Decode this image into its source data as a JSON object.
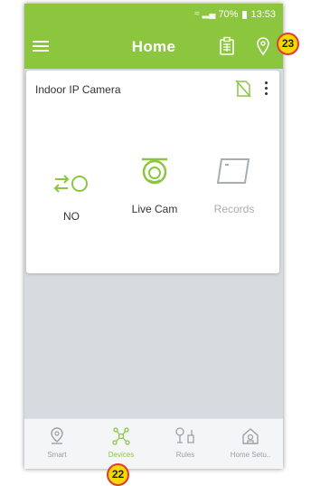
{
  "status_bar": {
    "battery": "70%",
    "time": "13:53"
  },
  "app_bar": {
    "title": "Home"
  },
  "device_card": {
    "name": "Indoor IP Camera",
    "actions": [
      {
        "label": "NO",
        "icon": "switch-icon"
      },
      {
        "label": "Live Cam",
        "icon": "camera-icon"
      },
      {
        "label": "Records",
        "icon": "records-icon"
      }
    ]
  },
  "tabs": [
    {
      "label": "Smart",
      "icon": "smart-icon",
      "active": false
    },
    {
      "label": "Devices",
      "icon": "devices-icon",
      "active": true
    },
    {
      "label": "Rules",
      "icon": "rules-icon",
      "active": false
    },
    {
      "label": "Home Setu..",
      "icon": "home-setup-icon",
      "active": false
    }
  ],
  "callouts": [
    "22",
    "23"
  ],
  "colors": {
    "brand_green": "#8cc63f",
    "background": "#d7dbdf",
    "disabled_gray": "#a8adb2",
    "callout_yellow": "#f5d800",
    "callout_border": "#e53935"
  }
}
